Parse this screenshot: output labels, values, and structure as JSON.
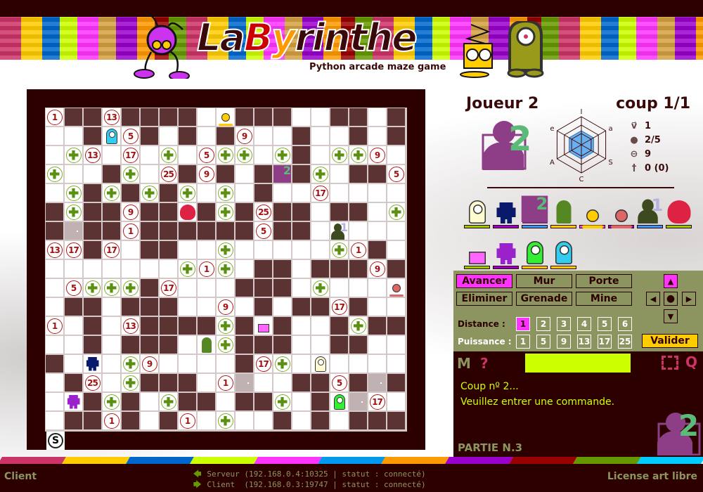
{
  "header": {
    "logo_parts": [
      "La",
      "B",
      "y",
      "rinthe"
    ],
    "tagline": "Python arcade maze game"
  },
  "colors": {
    "wall": "#5c3333",
    "accent": "#ff33ff",
    "lime": "#ccff00",
    "olive": "#8c9460",
    "dark": "#2d0000"
  },
  "maze": {
    "cols": 19,
    "rows": [
      [
        "1",
        "#",
        "#",
        "13",
        "#",
        "#",
        "#",
        "#",
        ".",
        "R:ant-yellow",
        "#",
        "#",
        "#",
        ".",
        ".",
        "#",
        "#",
        ".",
        "#"
      ],
      [
        ".",
        ".",
        "#",
        "R:cyc-cyan",
        "5",
        "#",
        ".",
        "#",
        ".",
        "#",
        "9",
        ".",
        ".",
        "#",
        ".",
        ".",
        "#",
        ".",
        "#"
      ],
      [
        ".",
        "+",
        "13",
        ".",
        "17",
        ".",
        "+",
        ".",
        "5",
        "+",
        "+",
        ".",
        "+",
        "#",
        ".",
        "+",
        "+",
        "9",
        "."
      ],
      [
        "+",
        ".",
        ".",
        "#",
        "+",
        ".",
        "25",
        "#",
        "9",
        "#",
        ".",
        "#",
        "P:2",
        "#",
        "+",
        ".",
        "#",
        "#",
        "5"
      ],
      [
        ".",
        "+",
        "#",
        "+",
        "#",
        "+",
        "#",
        "+",
        ".",
        "+",
        ".",
        "#",
        ".",
        ".",
        "17",
        ".",
        ".",
        ".",
        "."
      ],
      [
        "#",
        "+",
        "#",
        "#",
        "9",
        "#",
        "#",
        "R:red",
        "#",
        "+",
        "#",
        "25",
        "#",
        "#",
        ".",
        "#",
        "#",
        ".",
        "+"
      ],
      [
        "#",
        "D",
        "#",
        "#",
        "1",
        "#",
        "#",
        "#",
        "#",
        "#",
        "#",
        "5",
        "#",
        "#",
        ".",
        "P:1",
        ".",
        ".",
        "."
      ],
      [
        "13",
        "17",
        "#",
        "17",
        ".",
        "#",
        "#",
        ".",
        ".",
        "+",
        ".",
        ".",
        ".",
        ".",
        ".",
        "+",
        "1",
        "#",
        "."
      ],
      [
        ".",
        ".",
        ".",
        ".",
        ".",
        ".",
        ".",
        "+",
        "1",
        "+",
        ".",
        "#",
        "#",
        ".",
        "#",
        "#",
        "#",
        "9",
        "#"
      ],
      [
        ".",
        "5",
        "+",
        "+",
        "+",
        "#",
        "17",
        ".",
        ".",
        ".",
        "#",
        "#",
        "#",
        ".",
        "+",
        ".",
        ".",
        ".",
        "R:ant-pink"
      ],
      [
        ".",
        "#",
        "#",
        ".",
        "#",
        "#",
        "#",
        ".",
        ".",
        "9",
        ".",
        "#",
        ".",
        "#",
        "#",
        "17",
        "#",
        ".",
        "."
      ],
      [
        "1",
        ".",
        "#",
        ".",
        "13",
        "#",
        "#",
        "#",
        "#",
        "+",
        "#",
        "R:spring",
        "#",
        ".",
        ".",
        "#",
        "+",
        "#",
        "#"
      ],
      [
        ".",
        ".",
        "#",
        ".",
        "#",
        "#",
        "#",
        ".",
        "R:green",
        "+",
        "#",
        "#",
        "#",
        ".",
        ".",
        "#",
        "#",
        ".",
        "."
      ],
      [
        "#",
        ".",
        "R:bot-navy",
        ".",
        "+",
        "9",
        ".",
        ".",
        ".",
        ".",
        "#",
        "17",
        "+",
        ".",
        "R:cyc-cream",
        ".",
        ".",
        ".",
        "."
      ],
      [
        ".",
        "#",
        "25",
        ".",
        "+",
        "#",
        "#",
        "#",
        ".",
        "1",
        "D",
        ".",
        ".",
        "#",
        "#",
        "5",
        "#",
        "D",
        "#"
      ],
      [
        ".",
        "R:bot-purple",
        "#",
        "+",
        "#",
        ".",
        "+",
        "#",
        "#",
        ".",
        "#",
        "#",
        "+",
        ".",
        "#",
        "R:cyc-green",
        "D",
        "17",
        "."
      ],
      [
        ".",
        "#",
        "#",
        "1",
        "#",
        ".",
        "#",
        "1",
        ".",
        "+",
        ".",
        ".",
        "#",
        ".",
        "#",
        ".",
        "#",
        "#",
        "#"
      ]
    ],
    "start_badge": "S"
  },
  "player": {
    "title": "Joueur 2",
    "coup": "coup 1/1",
    "number": "2",
    "radar": {
      "labels": [
        "I",
        "a",
        "S",
        "C",
        "A",
        "e"
      ],
      "values": [
        0.5,
        0.5,
        0.5,
        0.5,
        0.5,
        0.5
      ]
    },
    "stats": [
      {
        "icon": "speed-icon",
        "glyph": "v⃗",
        "value": "1"
      },
      {
        "icon": "grenade-icon",
        "glyph": "●",
        "value": "2/5"
      },
      {
        "icon": "mine-icon",
        "glyph": "⊖",
        "value": "9"
      },
      {
        "icon": "cross-icon",
        "glyph": "†",
        "value": "0 (0)"
      }
    ]
  },
  "roster": [
    [
      {
        "kind": "cyc-cream",
        "bar": "#99cc00"
      },
      {
        "kind": "bot-navy",
        "bar": "#9900cc"
      },
      {
        "kind": "P:2",
        "bar": "#3399ff",
        "selected": true
      },
      {
        "kind": "green",
        "bar": "#ffcc00"
      },
      {
        "kind": "ant-yellow",
        "bar": "#ff33ff"
      },
      {
        "kind": "ant-pink",
        "bar": "#9900cc"
      },
      {
        "kind": "P:1",
        "bar": "#3399ff"
      },
      {
        "kind": "red",
        "bar": "#99cc00"
      }
    ],
    [
      {
        "kind": "spring",
        "bar": "#99cc00"
      },
      {
        "kind": "bot-purple",
        "bar": "#9900cc"
      },
      {
        "kind": "cyc-green",
        "bar": "#ffcc00"
      },
      {
        "kind": "cyc-cyan",
        "bar": "#ffcc00"
      }
    ]
  ],
  "commands": {
    "actions": [
      "Avancer",
      "Mur",
      "Porte",
      "Eliminer",
      "Grenade",
      "Mine"
    ],
    "active_action": "Avancer",
    "distance_label": "Distance :",
    "distance": [
      "1",
      "2",
      "3",
      "4",
      "5",
      "6"
    ],
    "distance_selected": "1",
    "power_label": "Puissance :",
    "power": [
      "1",
      "5",
      "9",
      "13",
      "17",
      "25"
    ],
    "validate": "Valider"
  },
  "console": {
    "m": "M",
    "help": "?",
    "quit": "Q",
    "input_value": "",
    "messages": [
      "Coup nº 2...",
      "Veuillez entrer une commande."
    ],
    "game_label": "PARTIE N.3"
  },
  "footer": {
    "left": "Client",
    "right": "License art libre",
    "server": "Serveur (192.168.0.4:10325 | statut : connecté)",
    "client": "Client  (192.168.0.3:19747 | statut : connecté)",
    "stripe": [
      "#cc3366",
      "#ffcc00",
      "#0066cc",
      "#ccff00",
      "#ff33ff",
      "#0099ee",
      "#ff9900",
      "#9900cc",
      "#990000",
      "#669900",
      "#00ccff"
    ]
  }
}
